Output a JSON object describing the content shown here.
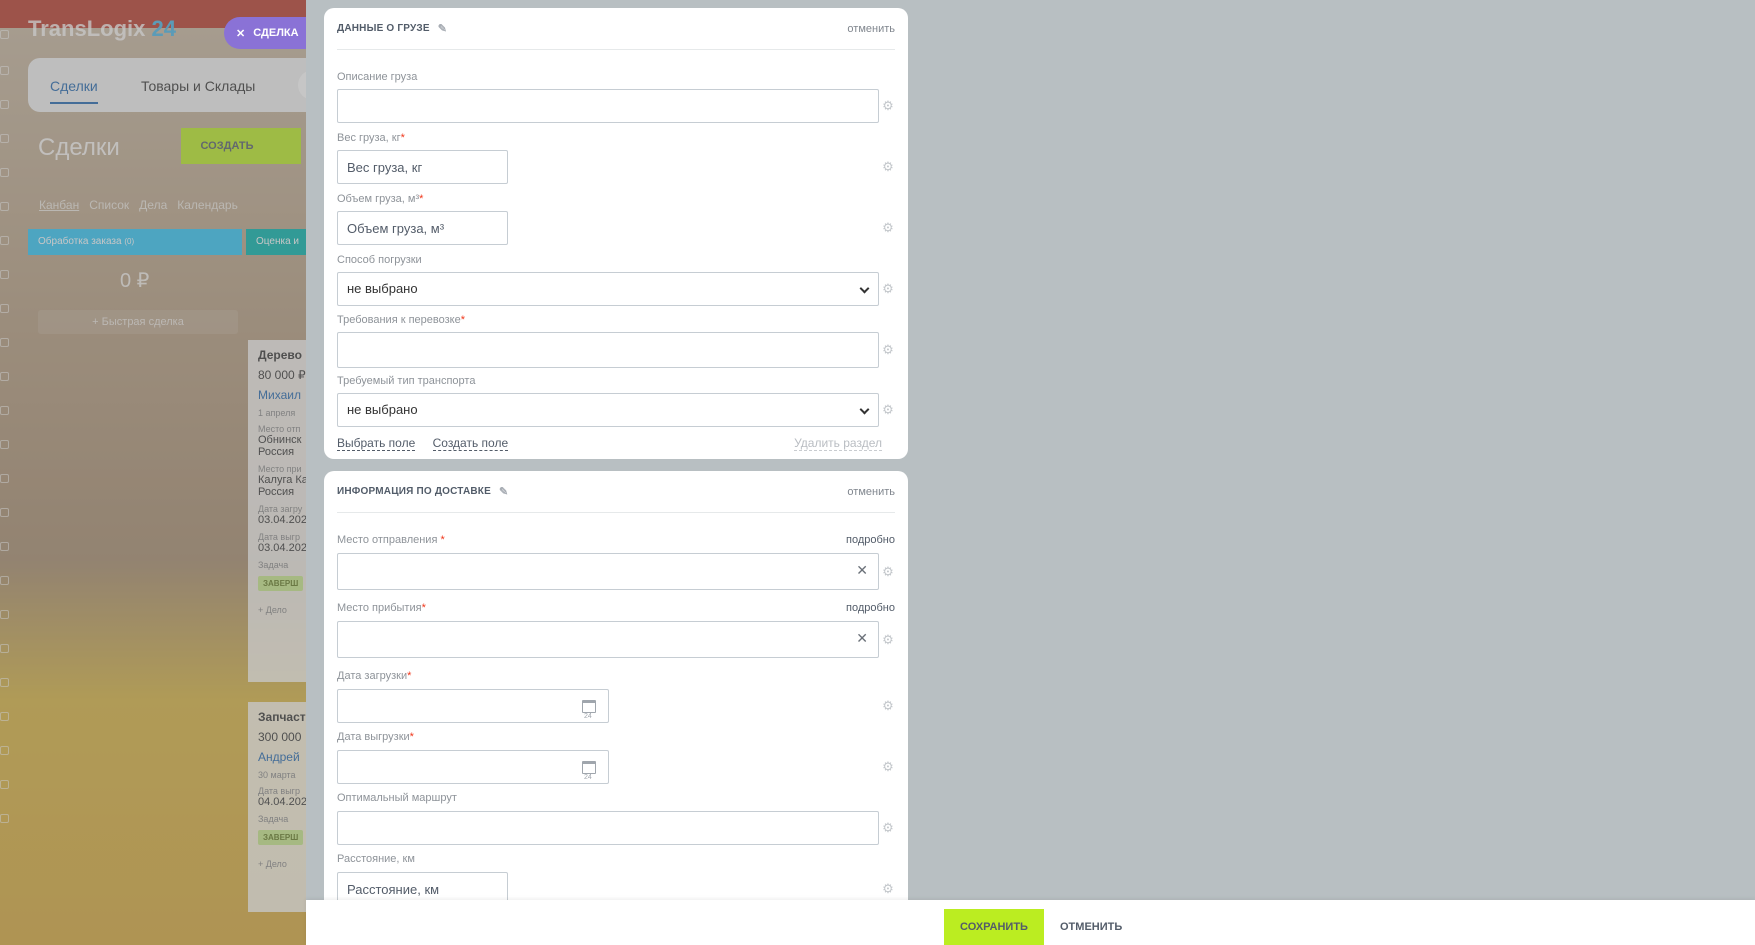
{
  "background": {
    "brand": "TransLogix",
    "brand_num": "24",
    "deal_chip": "СДЕЛКА",
    "tabs": [
      "Сделки",
      "Товары и Склады"
    ],
    "page_title": "Сделки",
    "create_label": "СОЗДАТЬ",
    "views": [
      "Канбан",
      "Список",
      "Дела",
      "Календарь"
    ],
    "stages": [
      {
        "label": "Обработка заказа",
        "count": "(0)"
      },
      {
        "label": "Оценка и"
      }
    ],
    "sum": "0 ₽",
    "quick_deal": "+ Быстрая сделка",
    "cards": [
      {
        "name": "Дерево",
        "price": "80 000 ₽",
        "person": "Михаил",
        "date": "1 апреля",
        "lines": [
          "Место отп",
          "Обнинск",
          "Россия",
          "Место при",
          "Калуга Ка",
          "Россия",
          "Дата загру",
          "03.04.202",
          "Дата выгр",
          "03.04.202",
          "Задача"
        ],
        "badge": "ЗАВЕРШ",
        "add": "+ Дело"
      },
      {
        "name": "Запчасти",
        "price": "300 000",
        "person": "Андрей",
        "date": "30 марта",
        "lines": [
          "Дата выгр",
          "04.04.202",
          "Задача"
        ],
        "badge": "ЗАВЕРШ",
        "add": "+ Дело"
      }
    ]
  },
  "cargo": {
    "title": "ДАННЫЕ О ГРУЗЕ",
    "cancel": "отменить",
    "fields": {
      "description": {
        "label": "Описание груза",
        "value": ""
      },
      "weight": {
        "label": "Вес груза, кг",
        "placeholder": "Вес груза, кг"
      },
      "volume": {
        "label": "Объем груза, м³",
        "placeholder": "Объем груза, м³"
      },
      "loading": {
        "label": "Способ погрузки",
        "value": "не выбрано"
      },
      "requirements": {
        "label": "Требования к перевозке",
        "value": ""
      },
      "transport": {
        "label": "Требуемый тип транспорта",
        "value": "не выбрано"
      }
    },
    "select_field": "Выбрать поле",
    "create_field": "Создать поле",
    "delete_section": "Удалить раздел"
  },
  "delivery": {
    "title": "ИНФОРМАЦИЯ ПО ДОСТАВКЕ",
    "cancel": "отменить",
    "more": "подробно",
    "fields": {
      "departure": {
        "label": "Место отправления ",
        "value": ""
      },
      "arrival": {
        "label": "Место прибытия",
        "value": ""
      },
      "load_date": {
        "label": "Дата загрузки",
        "value": ""
      },
      "unload_date": {
        "label": "Дата выгрузки",
        "value": ""
      },
      "route": {
        "label": "Оптимальный маршрут",
        "value": ""
      },
      "distance": {
        "label": "Расстояние, км",
        "placeholder": "Расстояние, км"
      }
    }
  },
  "footer": {
    "save": "СОХРАНИТЬ",
    "cancel": "ОТМЕНИТЬ"
  }
}
